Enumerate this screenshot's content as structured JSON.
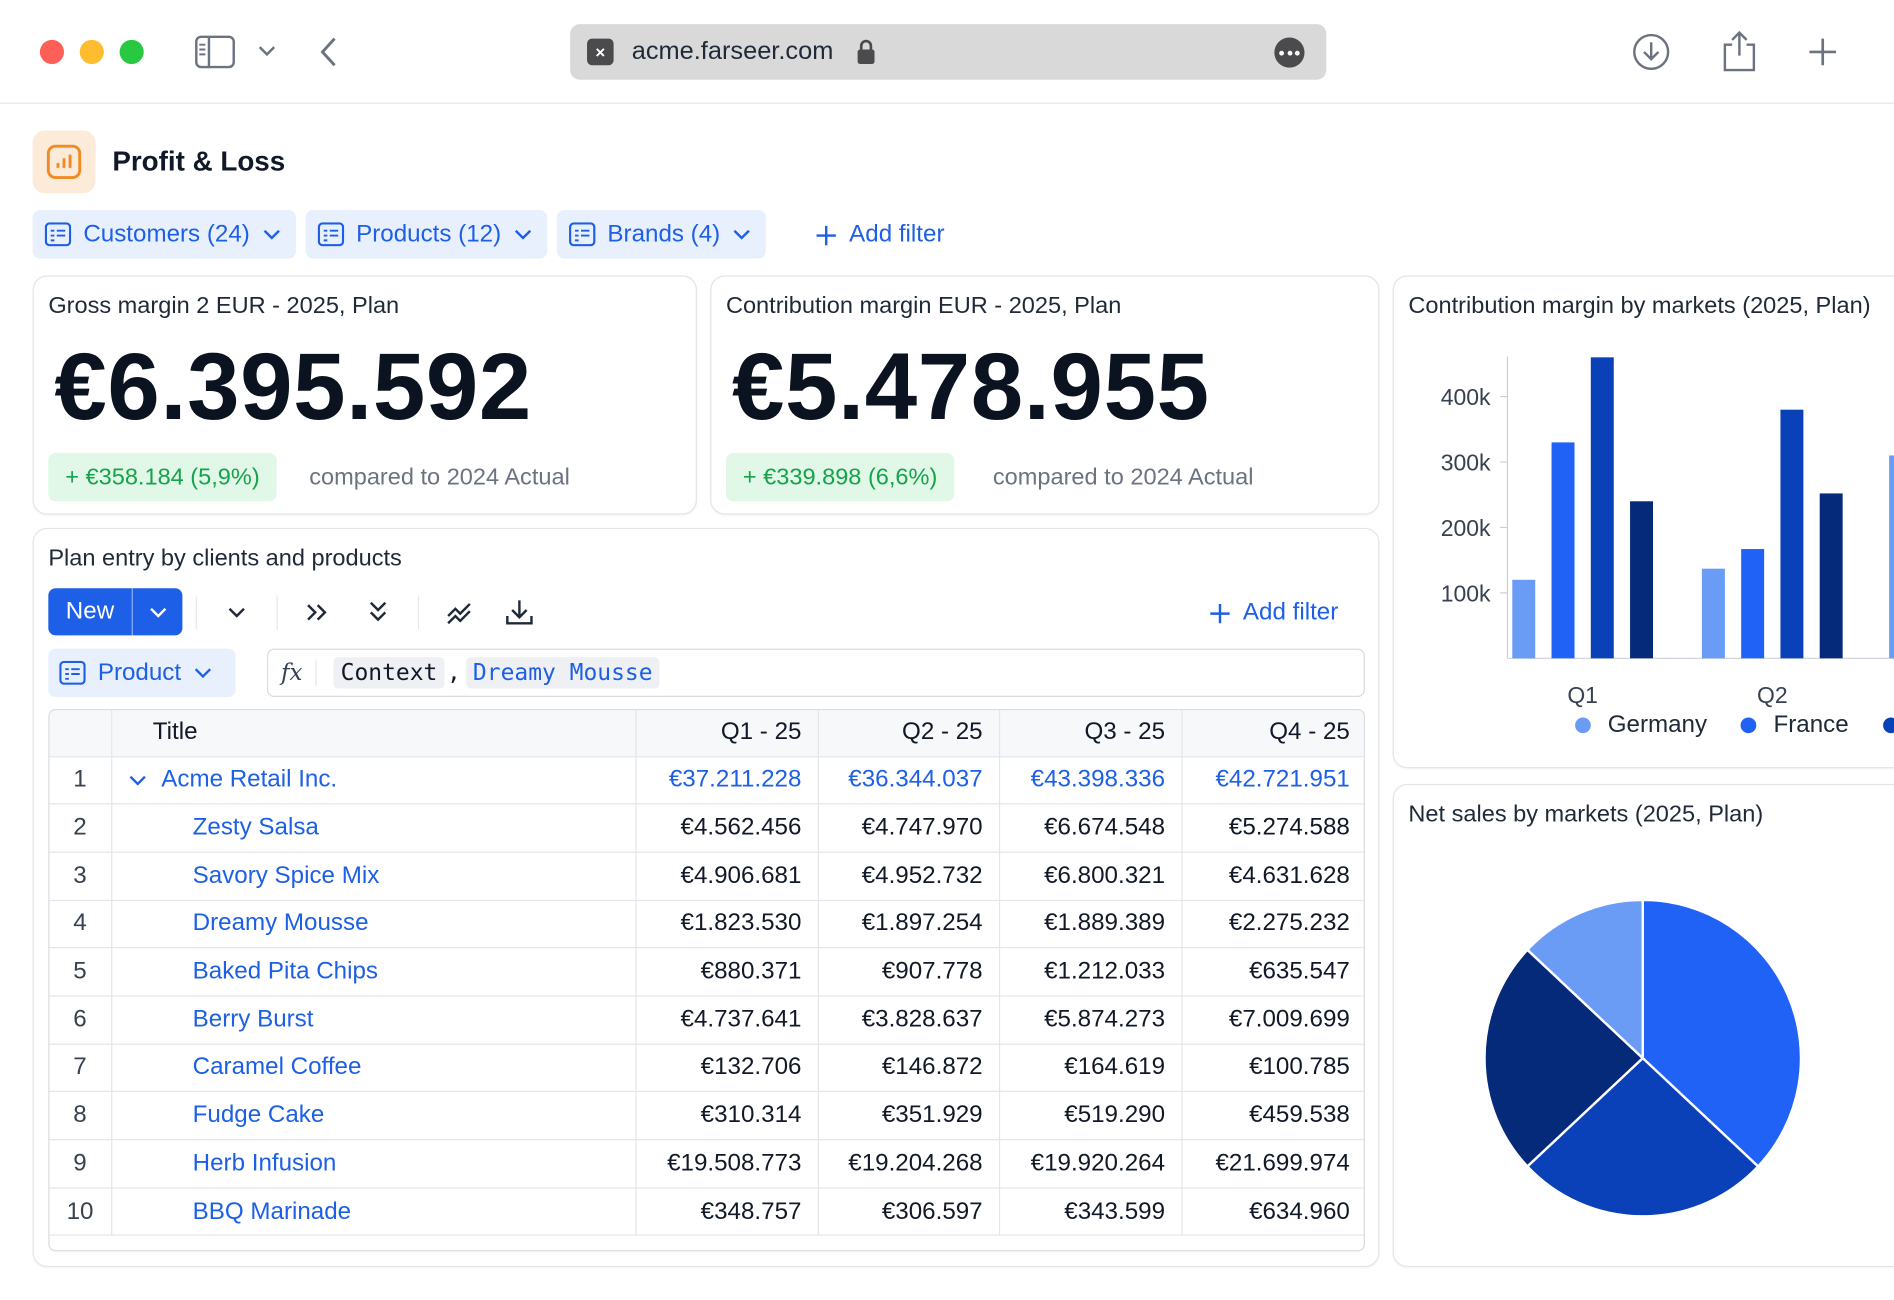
{
  "browser": {
    "url": "acme.farseer.com"
  },
  "page": {
    "title": "Profit & Loss"
  },
  "filters": [
    {
      "label": "Customers (24)"
    },
    {
      "label": "Products (12)"
    },
    {
      "label": "Brands (4)"
    }
  ],
  "add_filter_label": "Add filter",
  "kpis": [
    {
      "title": "Gross margin 2 EUR - 2025, Plan",
      "value": "€6.395.592",
      "delta": "+ €358.184 (5,9%)",
      "compare": "compared to 2024 Actual"
    },
    {
      "title": "Contribution margin EUR - 2025, Plan",
      "value": "€5.478.955",
      "delta": "+ €339.898 (6,6%)",
      "compare": "compared to 2024 Actual"
    }
  ],
  "plan": {
    "title": "Plan entry by clients and products",
    "new_label": "New",
    "add_filter_label": "Add filter",
    "dimension_chip": "Product",
    "formula": {
      "fx": "fx",
      "context": "Context",
      "comma": ",",
      "member": "Dreamy Mousse"
    },
    "columns": [
      "Title",
      "Q1 - 25",
      "Q2 - 25",
      "Q3 - 25",
      "Q4 - 25"
    ],
    "rows": [
      {
        "idx": "1",
        "title": "Acme Retail Inc.",
        "group": true,
        "values": [
          "€37.211.228",
          "€36.344.037",
          "€43.398.336",
          "€42.721.951"
        ]
      },
      {
        "idx": "2",
        "title": "Zesty Salsa",
        "group": false,
        "values": [
          "€4.562.456",
          "€4.747.970",
          "€6.674.548",
          "€5.274.588"
        ]
      },
      {
        "idx": "3",
        "title": "Savory Spice Mix",
        "group": false,
        "values": [
          "€4.906.681",
          "€4.952.732",
          "€6.800.321",
          "€4.631.628"
        ]
      },
      {
        "idx": "4",
        "title": "Dreamy Mousse",
        "group": false,
        "values": [
          "€1.823.530",
          "€1.897.254",
          "€1.889.389",
          "€2.275.232"
        ]
      },
      {
        "idx": "5",
        "title": "Baked Pita Chips",
        "group": false,
        "values": [
          "€880.371",
          "€907.778",
          "€1.212.033",
          "€635.547"
        ]
      },
      {
        "idx": "6",
        "title": "Berry Burst",
        "group": false,
        "values": [
          "€4.737.641",
          "€3.828.637",
          "€5.874.273",
          "€7.009.699"
        ]
      },
      {
        "idx": "7",
        "title": "Caramel Coffee",
        "group": false,
        "values": [
          "€132.706",
          "€146.872",
          "€164.619",
          "€100.785"
        ]
      },
      {
        "idx": "8",
        "title": "Fudge Cake",
        "group": false,
        "values": [
          "€310.314",
          "€351.929",
          "€519.290",
          "€459.538"
        ]
      },
      {
        "idx": "9",
        "title": "Herb Infusion",
        "group": false,
        "values": [
          "€19.508.773",
          "€19.204.268",
          "€19.920.264",
          "€21.699.974"
        ]
      },
      {
        "idx": "10",
        "title": "BBQ Marinade",
        "group": false,
        "values": [
          "€348.757",
          "€306.597",
          "€343.599",
          "€634.960"
        ]
      }
    ]
  },
  "colors": {
    "accent": "#1d5fe6",
    "positive": "#16a34a",
    "series": [
      "#6a9cf5",
      "#1f62f5",
      "#0a40b8",
      "#062a7a"
    ]
  },
  "chart_data": [
    {
      "type": "bar",
      "title": "Contribution margin by markets (2025, Plan)",
      "categories": [
        "Q1",
        "Q2"
      ],
      "yticks": [
        "100k",
        "200k",
        "300k",
        "400k"
      ],
      "ylim": [
        0,
        480000
      ],
      "series": [
        {
          "name": "Germany",
          "values": [
            120000,
            137000
          ]
        },
        {
          "name": "France",
          "values": [
            330000,
            167000
          ]
        },
        {
          "name": "",
          "values": [
            460000,
            380000
          ]
        },
        {
          "name": "",
          "values": [
            240000,
            252000
          ]
        }
      ],
      "grid": false,
      "legend": "bottom"
    },
    {
      "type": "pie",
      "title": "Net sales by markets (2025, Plan)",
      "values": [
        37,
        26,
        24,
        13
      ]
    }
  ]
}
